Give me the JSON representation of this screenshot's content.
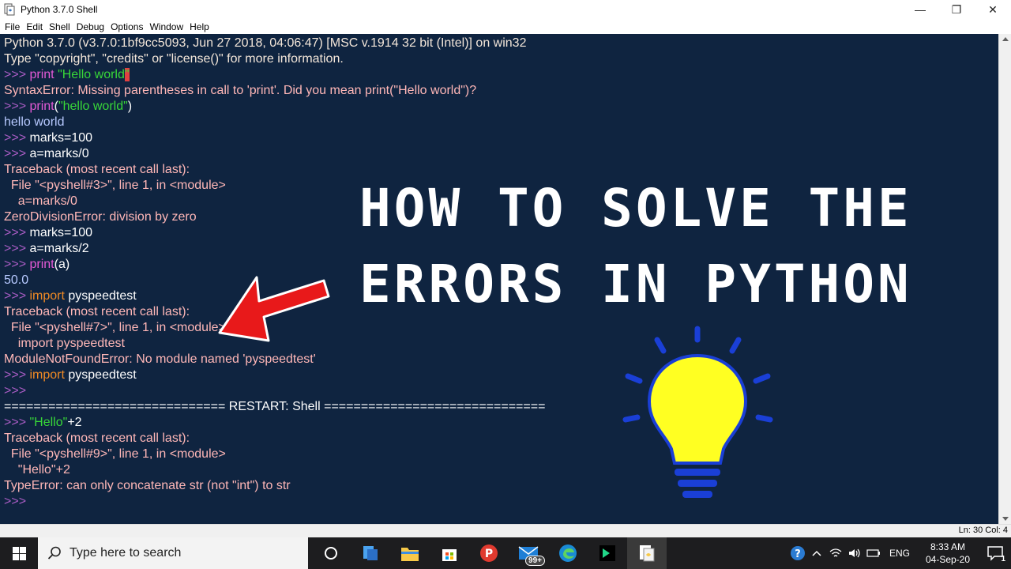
{
  "window": {
    "title": "Python 3.7.0 Shell",
    "controls": {
      "minimize": "—",
      "maximize": "❐",
      "close": "✕"
    }
  },
  "menu": [
    "File",
    "Edit",
    "Shell",
    "Debug",
    "Options",
    "Window",
    "Help"
  ],
  "shell": {
    "lines": [
      [
        [
          "Python 3.7.0 (v3.7.0:1bf9cc5093, Jun 27 2018, 04:06:47) [MSC v.1914 32 bit (Intel)] on win32",
          "info"
        ]
      ],
      [
        [
          "Type \"copyright\", \"credits\" or \"license()\" for more information.",
          "info"
        ]
      ],
      [
        [
          ">>> ",
          "prompt"
        ],
        [
          "print ",
          "kw"
        ],
        [
          "\"Hello world",
          "str"
        ],
        [
          "\"",
          "cursor"
        ]
      ],
      [
        [
          "SyntaxError: Missing parentheses in call to 'print'. Did you mean print(\"Hello world\")?",
          "err"
        ]
      ],
      [
        [
          ">>> ",
          "prompt"
        ],
        [
          "print",
          "kw"
        ],
        [
          "(",
          "plain"
        ],
        [
          "\"hello world\"",
          "str"
        ],
        [
          ")",
          "plain"
        ]
      ],
      [
        [
          "hello world",
          "out"
        ]
      ],
      [
        [
          ">>> ",
          "prompt"
        ],
        [
          "marks=100",
          "plain"
        ]
      ],
      [
        [
          ">>> ",
          "prompt"
        ],
        [
          "a=marks/0",
          "plain"
        ]
      ],
      [
        [
          "Traceback (most recent call last):",
          "err"
        ]
      ],
      [
        [
          "  File \"<pyshell#3>\", line 1, in <module>",
          "err"
        ]
      ],
      [
        [
          "    a=marks/0",
          "err"
        ]
      ],
      [
        [
          "ZeroDivisionError: division by zero",
          "err"
        ]
      ],
      [
        [
          ">>> ",
          "prompt"
        ],
        [
          "marks=100",
          "plain"
        ]
      ],
      [
        [
          ">>> ",
          "prompt"
        ],
        [
          "a=marks/2",
          "plain"
        ]
      ],
      [
        [
          ">>> ",
          "prompt"
        ],
        [
          "print",
          "kw"
        ],
        [
          "(a)",
          "plain"
        ]
      ],
      [
        [
          "50.0",
          "out"
        ]
      ],
      [
        [
          ">>> ",
          "prompt"
        ],
        [
          "import",
          "kw2"
        ],
        [
          " pyspeedtest",
          "plain"
        ]
      ],
      [
        [
          "Traceback (most recent call last):",
          "err"
        ]
      ],
      [
        [
          "  File \"<pyshell#7>\", line 1, in <module>",
          "err"
        ]
      ],
      [
        [
          "    import pyspeedtest",
          "err"
        ]
      ],
      [
        [
          "ModuleNotFoundError: No module named 'pyspeedtest'",
          "err"
        ]
      ],
      [
        [
          ">>> ",
          "prompt"
        ],
        [
          "import",
          "kw2"
        ],
        [
          " pyspeedtest",
          "plain"
        ]
      ],
      [
        [
          ">>>",
          "prompt"
        ]
      ],
      [
        [
          "============================== RESTART: Shell ==============================",
          "plain"
        ]
      ],
      [
        [
          ">>> ",
          "prompt"
        ],
        [
          "\"Hello\"",
          "str"
        ],
        [
          "+2",
          "plain"
        ]
      ],
      [
        [
          "Traceback (most recent call last):",
          "err"
        ]
      ],
      [
        [
          "  File \"<pyshell#9>\", line 1, in <module>",
          "err"
        ]
      ],
      [
        [
          "    \"Hello\"+2",
          "err"
        ]
      ],
      [
        [
          "TypeError: can only concatenate str (not \"int\") to str",
          "err"
        ]
      ],
      [
        [
          ">>>",
          "prompt"
        ]
      ]
    ]
  },
  "overlay": {
    "headline_line1": "HOW TO SOLVE THE",
    "headline_line2": "ERRORS IN PYTHON",
    "arrow_color": "#e8191a",
    "bulb_color": "#ffff22",
    "bulb_outline": "#1a3fd6"
  },
  "status": {
    "position": "Ln: 30  Col: 4"
  },
  "taskbar": {
    "search_placeholder": "Type here to search",
    "apps": [
      "task-view-icon",
      "python-icon",
      "file-explorer-icon",
      "store-icon",
      "psiphon-icon",
      "mail-icon",
      "edge-icon",
      "pycharm-icon",
      "idle-icon"
    ],
    "mail_badge": "99+",
    "language": "ENG",
    "time": "8:33 AM",
    "date": "04-Sep-20",
    "notification_count": "1"
  }
}
